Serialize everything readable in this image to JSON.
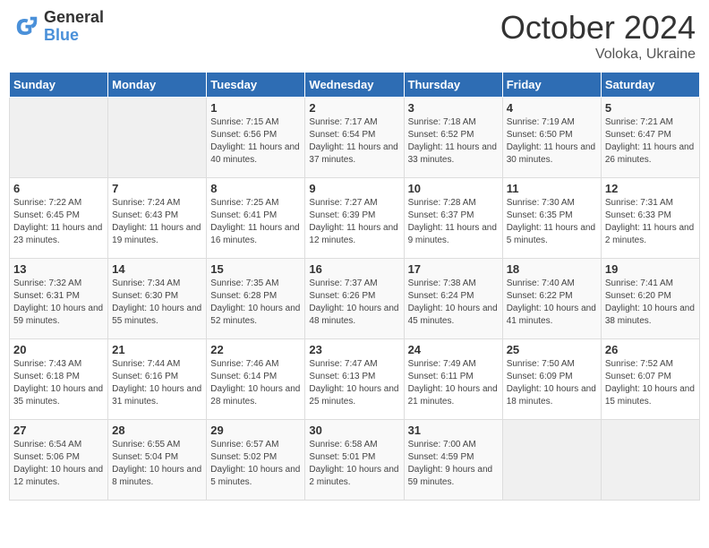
{
  "header": {
    "logo_general": "General",
    "logo_blue": "Blue",
    "month_title": "October 2024",
    "location": "Voloka, Ukraine"
  },
  "weekdays": [
    "Sunday",
    "Monday",
    "Tuesday",
    "Wednesday",
    "Thursday",
    "Friday",
    "Saturday"
  ],
  "weeks": [
    [
      {
        "day": "",
        "detail": ""
      },
      {
        "day": "",
        "detail": ""
      },
      {
        "day": "1",
        "detail": "Sunrise: 7:15 AM\nSunset: 6:56 PM\nDaylight: 11 hours and 40 minutes."
      },
      {
        "day": "2",
        "detail": "Sunrise: 7:17 AM\nSunset: 6:54 PM\nDaylight: 11 hours and 37 minutes."
      },
      {
        "day": "3",
        "detail": "Sunrise: 7:18 AM\nSunset: 6:52 PM\nDaylight: 11 hours and 33 minutes."
      },
      {
        "day": "4",
        "detail": "Sunrise: 7:19 AM\nSunset: 6:50 PM\nDaylight: 11 hours and 30 minutes."
      },
      {
        "day": "5",
        "detail": "Sunrise: 7:21 AM\nSunset: 6:47 PM\nDaylight: 11 hours and 26 minutes."
      }
    ],
    [
      {
        "day": "6",
        "detail": "Sunrise: 7:22 AM\nSunset: 6:45 PM\nDaylight: 11 hours and 23 minutes."
      },
      {
        "day": "7",
        "detail": "Sunrise: 7:24 AM\nSunset: 6:43 PM\nDaylight: 11 hours and 19 minutes."
      },
      {
        "day": "8",
        "detail": "Sunrise: 7:25 AM\nSunset: 6:41 PM\nDaylight: 11 hours and 16 minutes."
      },
      {
        "day": "9",
        "detail": "Sunrise: 7:27 AM\nSunset: 6:39 PM\nDaylight: 11 hours and 12 minutes."
      },
      {
        "day": "10",
        "detail": "Sunrise: 7:28 AM\nSunset: 6:37 PM\nDaylight: 11 hours and 9 minutes."
      },
      {
        "day": "11",
        "detail": "Sunrise: 7:30 AM\nSunset: 6:35 PM\nDaylight: 11 hours and 5 minutes."
      },
      {
        "day": "12",
        "detail": "Sunrise: 7:31 AM\nSunset: 6:33 PM\nDaylight: 11 hours and 2 minutes."
      }
    ],
    [
      {
        "day": "13",
        "detail": "Sunrise: 7:32 AM\nSunset: 6:31 PM\nDaylight: 10 hours and 59 minutes."
      },
      {
        "day": "14",
        "detail": "Sunrise: 7:34 AM\nSunset: 6:30 PM\nDaylight: 10 hours and 55 minutes."
      },
      {
        "day": "15",
        "detail": "Sunrise: 7:35 AM\nSunset: 6:28 PM\nDaylight: 10 hours and 52 minutes."
      },
      {
        "day": "16",
        "detail": "Sunrise: 7:37 AM\nSunset: 6:26 PM\nDaylight: 10 hours and 48 minutes."
      },
      {
        "day": "17",
        "detail": "Sunrise: 7:38 AM\nSunset: 6:24 PM\nDaylight: 10 hours and 45 minutes."
      },
      {
        "day": "18",
        "detail": "Sunrise: 7:40 AM\nSunset: 6:22 PM\nDaylight: 10 hours and 41 minutes."
      },
      {
        "day": "19",
        "detail": "Sunrise: 7:41 AM\nSunset: 6:20 PM\nDaylight: 10 hours and 38 minutes."
      }
    ],
    [
      {
        "day": "20",
        "detail": "Sunrise: 7:43 AM\nSunset: 6:18 PM\nDaylight: 10 hours and 35 minutes."
      },
      {
        "day": "21",
        "detail": "Sunrise: 7:44 AM\nSunset: 6:16 PM\nDaylight: 10 hours and 31 minutes."
      },
      {
        "day": "22",
        "detail": "Sunrise: 7:46 AM\nSunset: 6:14 PM\nDaylight: 10 hours and 28 minutes."
      },
      {
        "day": "23",
        "detail": "Sunrise: 7:47 AM\nSunset: 6:13 PM\nDaylight: 10 hours and 25 minutes."
      },
      {
        "day": "24",
        "detail": "Sunrise: 7:49 AM\nSunset: 6:11 PM\nDaylight: 10 hours and 21 minutes."
      },
      {
        "day": "25",
        "detail": "Sunrise: 7:50 AM\nSunset: 6:09 PM\nDaylight: 10 hours and 18 minutes."
      },
      {
        "day": "26",
        "detail": "Sunrise: 7:52 AM\nSunset: 6:07 PM\nDaylight: 10 hours and 15 minutes."
      }
    ],
    [
      {
        "day": "27",
        "detail": "Sunrise: 6:54 AM\nSunset: 5:06 PM\nDaylight: 10 hours and 12 minutes."
      },
      {
        "day": "28",
        "detail": "Sunrise: 6:55 AM\nSunset: 5:04 PM\nDaylight: 10 hours and 8 minutes."
      },
      {
        "day": "29",
        "detail": "Sunrise: 6:57 AM\nSunset: 5:02 PM\nDaylight: 10 hours and 5 minutes."
      },
      {
        "day": "30",
        "detail": "Sunrise: 6:58 AM\nSunset: 5:01 PM\nDaylight: 10 hours and 2 minutes."
      },
      {
        "day": "31",
        "detail": "Sunrise: 7:00 AM\nSunset: 4:59 PM\nDaylight: 9 hours and 59 minutes."
      },
      {
        "day": "",
        "detail": ""
      },
      {
        "day": "",
        "detail": ""
      }
    ]
  ]
}
